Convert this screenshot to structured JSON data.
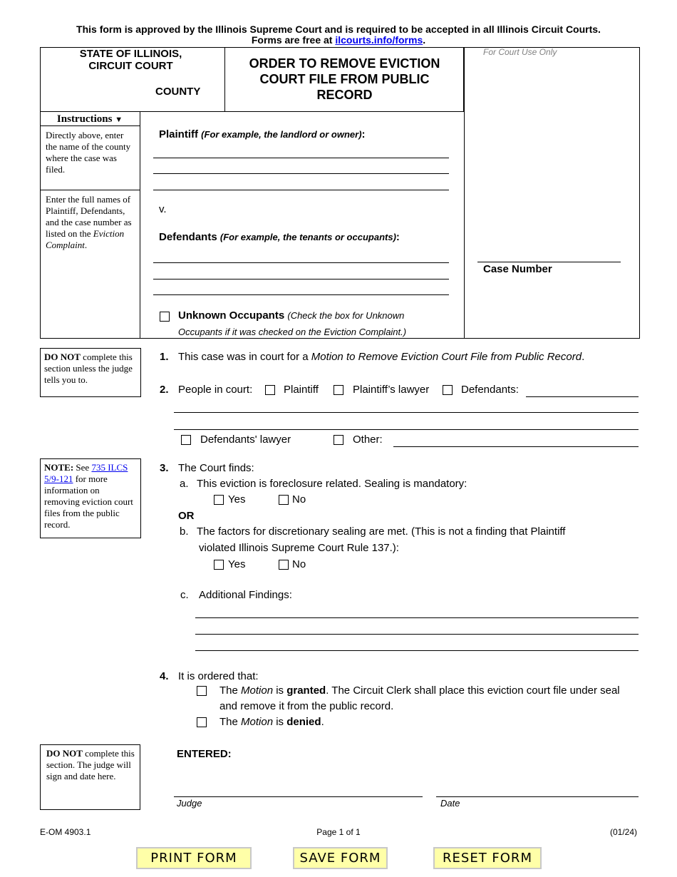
{
  "notice": {
    "line1": "This form is approved by the Illinois Supreme Court and is required to be accepted in all Illinois Circuit Courts.",
    "line2_prefix": "Forms are free at ",
    "line2_link": "ilcourts.info/forms",
    "line2_suffix": "."
  },
  "header": {
    "state_line1": "STATE OF ILLINOIS,",
    "state_line2": "CIRCUIT COURT",
    "county_label": "COUNTY",
    "county_value": "",
    "title": "ORDER TO REMOVE EVICTION COURT FILE FROM PUBLIC RECORD",
    "court_use_only": "For Court Use Only",
    "case_number_label": "Case Number",
    "case_number_value": ""
  },
  "instructions": {
    "header": "Instructions",
    "county_note": "Directly above, enter the name of the county where the case was filed.",
    "names_note_prefix": "Enter the full names of Plaintiff, Defendants, and the case number as listed on the ",
    "names_note_italic": "Eviction Complaint",
    "names_note_suffix": "."
  },
  "parties": {
    "plaintiff_label": "Plaintiff",
    "plaintiff_hint": "(For example, the landlord or owner)",
    "plaintiff_lines": [
      "",
      "",
      ""
    ],
    "versus": "v.",
    "defendants_label": "Defendants",
    "defendants_hint": "(For example, the tenants or occupants)",
    "defendants_lines": [
      "",
      "",
      ""
    ],
    "unknown_occupants_label": "Unknown Occupants",
    "unknown_occupants_hint_1": "(Check the box for Unknown",
    "unknown_occupants_hint_2": "Occupants if it was checked on the Eviction Complaint.)",
    "unknown_occupants_checked": false
  },
  "side_notes": {
    "do_not_1_bold": "DO NOT",
    "do_not_1_text": " complete this section unless the judge tells you to.",
    "note_bold": "NOTE:",
    "note_pre": " See ",
    "note_link": "735 ILCS 5/9-121",
    "note_post": " for more information on removing eviction court files from the public record.",
    "do_not_2_bold": "DO NOT",
    "do_not_2_text": " complete this section. The judge will sign and date here."
  },
  "items": {
    "item1_num": "1.",
    "item1_text": "This case was in court for a ",
    "item1_italic": "Motion to Remove Eviction Court File from Public Record",
    "item1_end": ".",
    "item2_num": "2.",
    "item2_label": "People in court:",
    "people": [
      {
        "label": "Plaintiff",
        "checked": false
      },
      {
        "label": "Plaintiff’s lawyer",
        "checked": false
      },
      {
        "label": "Defendants:",
        "checked": false
      },
      {
        "label": "Defendants' lawyer",
        "checked": false
      },
      {
        "label": "Other:",
        "checked": false
      }
    ],
    "item3_num": "3.",
    "item3_label": "The Court finds:",
    "a_letter": "a.",
    "a_text": "This eviction is foreclosure related. Sealing is mandatory:",
    "yes": "Yes",
    "no": "No",
    "or": "OR",
    "b_letter": "b.",
    "b_text_1": "The factors for discretionary sealing are met. (This is not a finding that Plaintiff",
    "b_text_2": "violated Illinois Supreme Court Rule 137.):",
    "c_letter": "c.",
    "c_text": "Additional Findings:",
    "item4_num": "4.",
    "item4_label": "It is ordered that:",
    "granted_pre": "The ",
    "granted_motion": "Motion",
    "granted_is": " is ",
    "granted_bold": "granted",
    "granted_post_1": ". The Circuit Clerk shall place this eviction court file under seal",
    "granted_post_2": "and remove it from the public record.",
    "denied_pre": "The ",
    "denied_motion": "Motion",
    "denied_is": " is ",
    "denied_bold": "denied",
    "denied_end": "."
  },
  "signature": {
    "entered": "ENTERED:",
    "judge_label": "Judge",
    "date_label": "Date"
  },
  "footer": {
    "form_code": "E-OM 4903.1",
    "page": "Page 1 of 1",
    "revision": "(01/24)"
  },
  "buttons": {
    "print": "PRINT FORM",
    "save": "SAVE FORM",
    "reset": "RESET FORM"
  }
}
